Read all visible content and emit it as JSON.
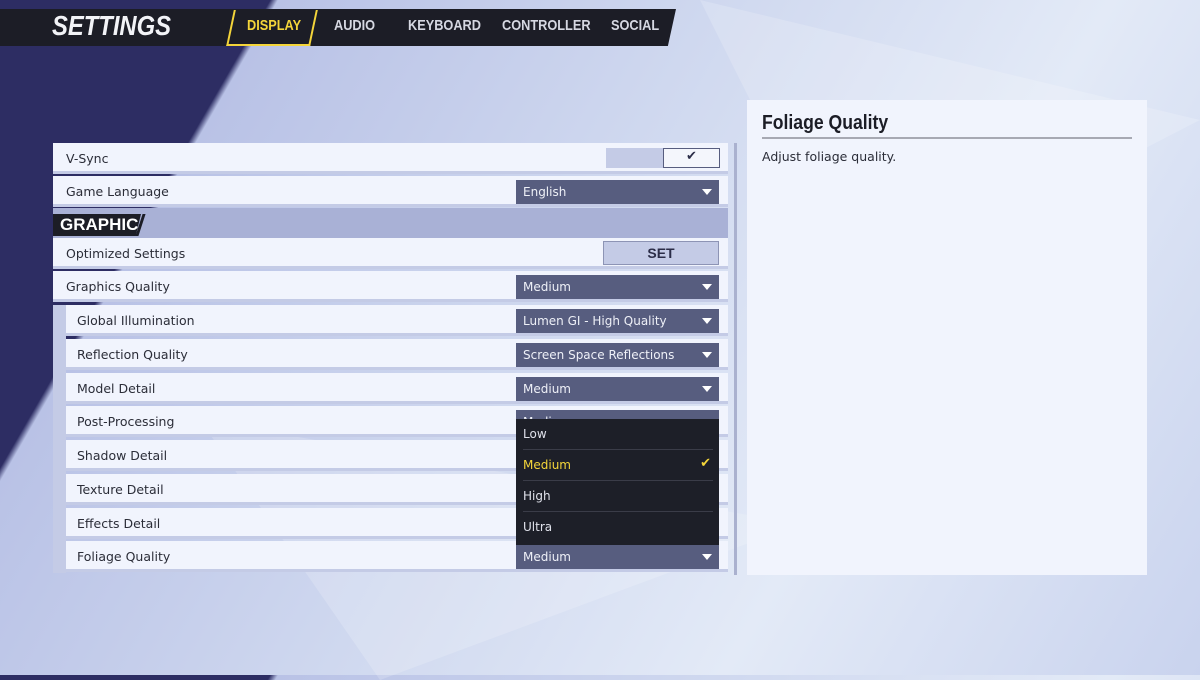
{
  "header": {
    "title": "SETTINGS",
    "tabs": [
      {
        "label": "DISPLAY",
        "active": true
      },
      {
        "label": "AUDIO"
      },
      {
        "label": "KEYBOARD"
      },
      {
        "label": "CONTROLLER"
      },
      {
        "label": "SOCIAL"
      }
    ]
  },
  "settings": {
    "vsync": {
      "label": "V-Sync",
      "checked": true
    },
    "language": {
      "label": "Game Language",
      "value": "English"
    },
    "section": "GRAPHICS",
    "optimized": {
      "label": "Optimized Settings",
      "button": "SET"
    },
    "graphics_quality": {
      "label": "Graphics Quality",
      "value": "Medium"
    },
    "sub": [
      {
        "label": "Global Illumination",
        "value": "Lumen GI - High Quality"
      },
      {
        "label": "Reflection Quality",
        "value": "Screen Space Reflections"
      },
      {
        "label": "Model Detail",
        "value": "Medium"
      },
      {
        "label": "Post-Processing",
        "value": "Medium"
      },
      {
        "label": "Shadow Detail",
        "value": ""
      },
      {
        "label": "Texture Detail",
        "value": ""
      },
      {
        "label": "Effects Detail",
        "value": ""
      },
      {
        "label": "Foliage Quality",
        "value": "Medium"
      }
    ]
  },
  "dropdown": {
    "options": [
      "Low",
      "Medium",
      "High",
      "Ultra"
    ],
    "selected": "Medium"
  },
  "info": {
    "title": "Foliage Quality",
    "description": "Adjust foliage quality."
  },
  "colors": {
    "accent": "#f4d53a",
    "dropdown": "#575d7f",
    "bar": "#1c1d26"
  }
}
